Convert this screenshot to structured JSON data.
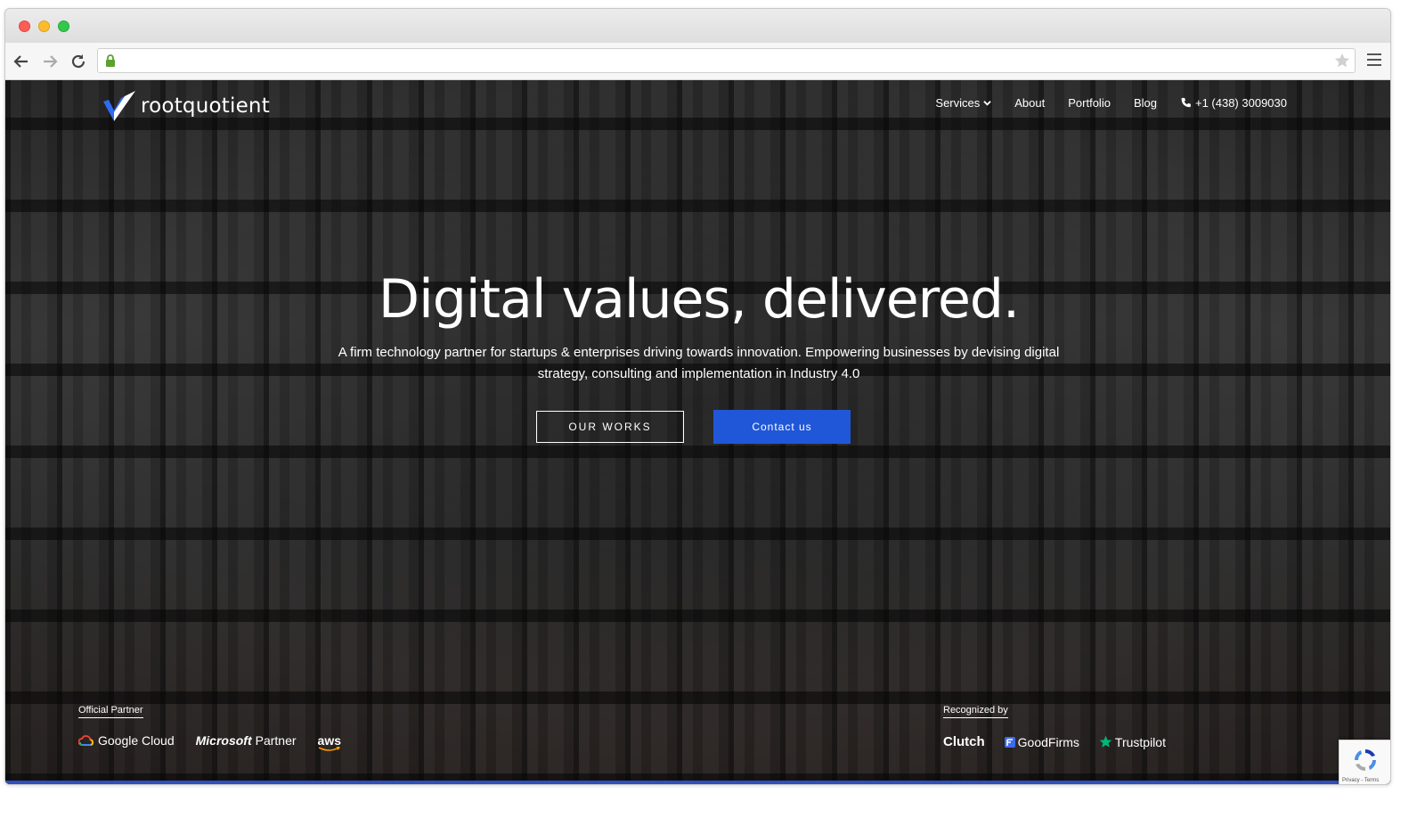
{
  "browser": {
    "url": "",
    "icons": {
      "back": "arrow-left-icon",
      "forward": "arrow-right-icon",
      "reload": "reload-icon",
      "lock": "lock-icon",
      "bookmark": "star-icon",
      "menu": "hamburger-menu-icon"
    }
  },
  "site": {
    "brand": "rootquotient",
    "accent_color": "#2057d8",
    "nav": {
      "services": "Services",
      "about": "About",
      "portfolio": "Portfolio",
      "blog": "Blog",
      "phone": "+1 (438) 3009030"
    }
  },
  "hero": {
    "title": "Digital values, delivered.",
    "subtitle": "A firm technology partner for startups & enterprises driving towards innovation. Empowering businesses by devising digital strategy, consulting and implementation in Industry 4.0",
    "btn_works": "OUR WORKS",
    "btn_contact": "Contact us"
  },
  "partners": {
    "label": "Official Partner",
    "google": "Google Cloud",
    "microsoft_brand": "Microsoft",
    "microsoft_suffix": "Partner",
    "aws": "aws"
  },
  "recognized": {
    "label": "Recognized by",
    "clutch": "Clutch",
    "goodfirms": "GoodFirms",
    "trustpilot": "Trustpilot"
  },
  "recaptcha": {
    "links": "Privacy - Terms"
  }
}
